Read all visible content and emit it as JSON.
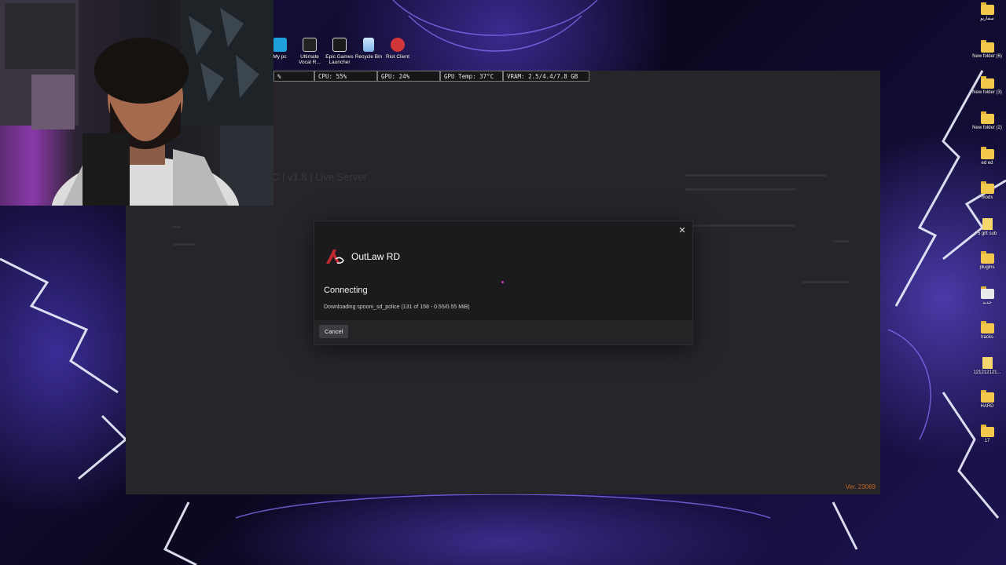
{
  "desktop": {
    "top_icons": [
      {
        "label": "My pc",
        "icon": "computer-icon"
      },
      {
        "label": "Ultimate Vocal R...",
        "icon": "app-icon"
      },
      {
        "label": "Epic Games Launcher",
        "icon": "epic-games-icon"
      },
      {
        "label": "Recycle Bin",
        "icon": "recycle-bin-icon"
      },
      {
        "label": "Riot Client",
        "icon": "riot-client-icon"
      }
    ],
    "right_icons": [
      {
        "label": "سفاريو",
        "icon": "folder-icon"
      },
      {
        "label": "New folder (6)",
        "icon": "folder-icon"
      },
      {
        "label": "New folder (3)",
        "icon": "folder-icon"
      },
      {
        "label": "New folder (2)",
        "icon": "folder-icon"
      },
      {
        "label": "ed ed",
        "icon": "folder-icon"
      },
      {
        "label": "mods",
        "icon": "folder-icon"
      },
      {
        "label": "5 gift sub",
        "icon": "file-icon"
      },
      {
        "label": "plugins",
        "icon": "folder-icon"
      },
      {
        "label": "جديد",
        "icon": "folder-icon"
      },
      {
        "label": "tracks",
        "icon": "folder-icon"
      },
      {
        "label": "121212121...",
        "icon": "file-icon"
      },
      {
        "label": "HARD",
        "icon": "folder-icon"
      },
      {
        "label": "17",
        "icon": "folder-icon"
      }
    ]
  },
  "perf_overlay": {
    "first": "%",
    "cpu": "CPU: 55%",
    "gpu": "GPU: 24%",
    "gpu_temp": "GPU Temp: 37°C",
    "vram": "VRAM: 2.5/4.4/7.8 GB"
  },
  "launcher": {
    "server_text": "C | v1.8 | Live Server",
    "version": "Ver. 23069"
  },
  "dialog": {
    "app_name": "OutLaw RD",
    "status": "Connecting",
    "detail": "Downloading spooni_sd_police (131 of 158 - 0.55/0.55 MiB)",
    "cancel_label": "Cancel",
    "close_icon": "close-icon"
  },
  "colors": {
    "dialog_bg": "#1b1a1d",
    "launcher_bg": "#27252a",
    "version_accent": "#c66a24",
    "logo_red": "#c0282f"
  }
}
